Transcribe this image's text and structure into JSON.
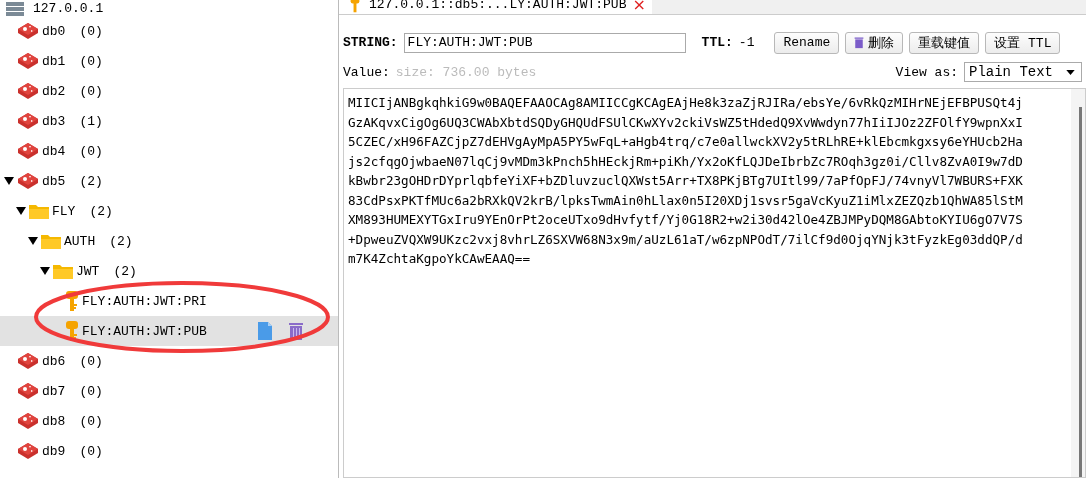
{
  "tree": {
    "server": "127.0.0.1",
    "items": [
      {
        "kind": "database",
        "name": "db0",
        "count": "(0)",
        "expanded": false,
        "selected": false
      },
      {
        "kind": "database",
        "name": "db1",
        "count": "(0)",
        "expanded": false,
        "selected": false
      },
      {
        "kind": "database",
        "name": "db2",
        "count": "(0)",
        "expanded": false,
        "selected": false
      },
      {
        "kind": "database",
        "name": "db3",
        "count": "(1)",
        "expanded": false,
        "selected": false
      },
      {
        "kind": "database",
        "name": "db4",
        "count": "(0)",
        "expanded": false,
        "selected": false
      },
      {
        "kind": "database",
        "name": "db5",
        "count": "(2)",
        "expanded": true,
        "selected": false,
        "children": [
          {
            "kind": "folder",
            "name": "FLY",
            "count": "(2)",
            "expanded": true,
            "selected": false,
            "children": [
              {
                "kind": "folder",
                "name": "AUTH",
                "count": "(2)",
                "expanded": true,
                "selected": false,
                "children": [
                  {
                    "kind": "folder",
                    "name": "JWT",
                    "count": "(2)",
                    "expanded": true,
                    "selected": false,
                    "children": [
                      {
                        "kind": "key",
                        "name": "FLY:AUTH:JWT:PRI",
                        "selected": false
                      },
                      {
                        "kind": "key",
                        "name": "FLY:AUTH:JWT:PUB",
                        "selected": true
                      }
                    ]
                  }
                ]
              }
            ]
          }
        ]
      },
      {
        "kind": "database",
        "name": "db6",
        "count": "(0)",
        "expanded": false,
        "selected": false
      },
      {
        "kind": "database",
        "name": "db7",
        "count": "(0)",
        "expanded": false,
        "selected": false
      },
      {
        "kind": "database",
        "name": "db8",
        "count": "(0)",
        "expanded": false,
        "selected": false
      },
      {
        "kind": "database",
        "name": "db9",
        "count": "(0)",
        "expanded": false,
        "selected": false
      }
    ]
  },
  "tab": {
    "title": "127.0.0.1::db5:...LY:AUTH:JWT:PUB",
    "close": "×"
  },
  "key_bar": {
    "type_label": "STRING:",
    "key": "FLY:AUTH:JWT:PUB",
    "ttl_label": "TTL:",
    "ttl": "-1",
    "buttons": [
      {
        "label": "Rename",
        "icon": false
      },
      {
        "label": "删除",
        "icon": true
      },
      {
        "label": "重载键值",
        "icon": false
      },
      {
        "label": "设置 TTL",
        "icon": false
      }
    ]
  },
  "value_bar": {
    "label": "Value:",
    "size": "size: 736.00 bytes",
    "view_as_label": "View as:",
    "view_as": "Plain Text"
  },
  "value_lines": [
    "MIICIjANBgkqhkiG9w0BAQEFAAOCAg8AMIICCgKCAgEAjHe8k3zaZjRJIRa/ebsYe/6vRkQzMIHrNEjEFBPUSQt4j",
    "GzAKqvxCigOg6UQ3CWAbXbtdSQDyGHQUdFSUlCKwXYv2ckiVsWZ5tHdedQ9XvWwdyn77hIiIJOz2ZFOlfY9wpnXxI",
    "5CZEC/xH96FAZCjpZ7dEHVgAyMpA5PY5wFqL+aHgb4trq/c7e0allwckXV2y5tRLhRE+klEbcmkgxsy6eYHUcb2Ha",
    "js2cfqgOjwbaeN07lqCj9vMDm3kPnch5hHEckjRm+piKh/Yx2oKfLQJDeIbrbZc7ROqh3gz0i/Cllv8ZvA0I9w7dD",
    "kBwbr23gOHDrDYprlqbfeYiXF+bZDluvzuclQXWst5Arr+TX8PKjBTg7UItl99/7aPfOpFJ/74vnyVl7WBURS+FXK",
    "83CdPsxPKTfMUc6a2bRXkQV2krB/lpksTwmAin0hLlax0n5I20XDj1svsr5gaVcKyuZ1iMlxZEZQzb1QhWA85lStM",
    "XM893HUMEXYTGxIru9YEnOrPt2oceUTxo9dHvfytf/Yj0G18R2+w2i30d42lOe4ZBJMPyDQM8GAbtoKYIU6gO7V7S",
    "+DpweuZVQXW9UKzc2vxj8vhrLZ6SXVW68N3x9m/aUzL61aT/w6zpNPOdT/7ilCf9d0OjqYNjk3tFyzkEg03ddQP/d",
    "m7K4ZchtaKgpoYkCAwEAAQ=="
  ]
}
